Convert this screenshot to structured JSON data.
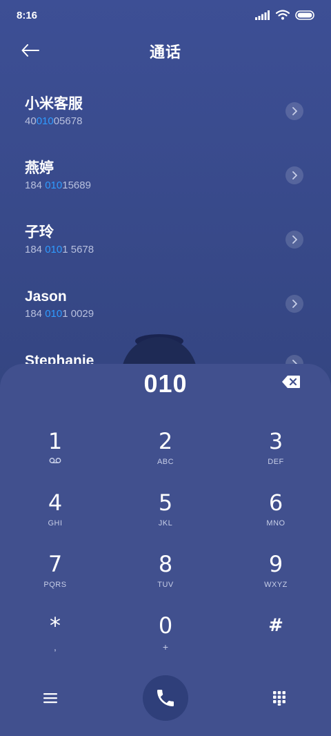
{
  "status_bar": {
    "time": "8:16"
  },
  "header": {
    "title": "通话"
  },
  "contacts": [
    {
      "name": "小米客服",
      "number_pre": "40",
      "number_match": "010",
      "number_post": "05678"
    },
    {
      "name": "燕婷",
      "number_pre": "184 ",
      "number_match": "010",
      "number_post": "15689"
    },
    {
      "name": "子玲",
      "number_pre": "184 ",
      "number_match": "010",
      "number_post": "1 5678"
    },
    {
      "name": "Jason",
      "number_pre": "184 ",
      "number_match": "010",
      "number_post": "1 0029"
    },
    {
      "name": "Stephanie",
      "number_pre": "",
      "number_match": "",
      "number_post": ""
    }
  ],
  "dialpad": {
    "input": "010",
    "keys": [
      {
        "digit": "1",
        "letters": ""
      },
      {
        "digit": "2",
        "letters": "ABC"
      },
      {
        "digit": "3",
        "letters": "DEF"
      },
      {
        "digit": "4",
        "letters": "GHI"
      },
      {
        "digit": "5",
        "letters": "JKL"
      },
      {
        "digit": "6",
        "letters": "MNO"
      },
      {
        "digit": "7",
        "letters": "PQRS"
      },
      {
        "digit": "8",
        "letters": "TUV"
      },
      {
        "digit": "9",
        "letters": "WXYZ"
      },
      {
        "digit": "*",
        "letters": ","
      },
      {
        "digit": "0",
        "letters": "+"
      },
      {
        "digit": "#",
        "letters": ""
      }
    ]
  },
  "icons": {
    "back": "back-arrow-icon",
    "chevron": "chevron-right-icon",
    "backspace": "backspace-icon",
    "voicemail": "voicemail-icon",
    "menu": "menu-icon",
    "call": "phone-icon",
    "keypad": "keypad-icon"
  },
  "colors": {
    "background": "#3d4f95",
    "dialpad": "#41508e",
    "match_highlight": "#2f9bff",
    "secondary_text": "#b8c0de"
  }
}
